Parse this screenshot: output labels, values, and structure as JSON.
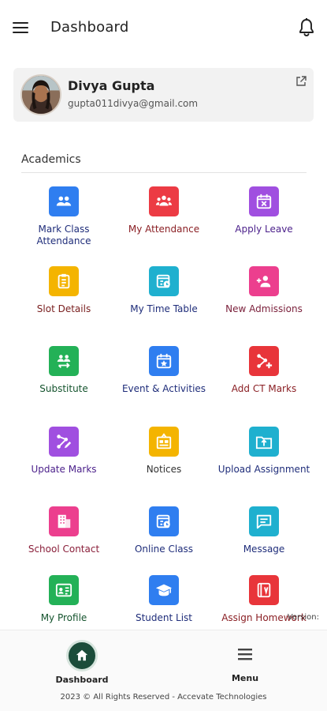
{
  "appbar": {
    "title": "Dashboard"
  },
  "profile": {
    "name": "Divya Gupta",
    "email": "gupta011divya@gmail.com"
  },
  "section": {
    "title": "Academics"
  },
  "tiles": [
    {
      "label": "Mark Class Attendance",
      "icon": "attendance-group-icon",
      "color": "#2f7ef0",
      "text_color": "#1f2d7a"
    },
    {
      "label": "My Attendance",
      "icon": "people-icon",
      "color": "#ec3b44",
      "text_color": "#8a1f24"
    },
    {
      "label": "Apply Leave",
      "icon": "calendar-x-icon",
      "color": "#a04fe0",
      "text_color": "#4a1f8a"
    },
    {
      "label": "Slot Details",
      "icon": "clipboard-icon",
      "color": "#f4b400",
      "text_color": "#7a2020"
    },
    {
      "label": "My Time Table",
      "icon": "timetable-icon",
      "color": "#1fb0cf",
      "text_color": "#1f2d7a"
    },
    {
      "label": "New Admissions",
      "icon": "add-user-icon",
      "color": "#ec3f8e",
      "text_color": "#7a1f3a"
    },
    {
      "label": "Substitute",
      "icon": "swap-users-icon",
      "color": "#23b157",
      "text_color": "#14532d"
    },
    {
      "label": "Event & Activities",
      "icon": "calendar-star-icon",
      "color": "#2f7ef0",
      "text_color": "#1f2d7a"
    },
    {
      "label": "Add CT Marks",
      "icon": "graph-plus-icon",
      "color": "#e8353a",
      "text_color": "#8a1f24"
    },
    {
      "label": "Update Marks",
      "icon": "graph-edit-icon",
      "color": "#a04fe0",
      "text_color": "#4a1f8a"
    },
    {
      "label": "Notices",
      "icon": "notice-board-icon",
      "color": "#f4b400",
      "text_color": "#333333"
    },
    {
      "label": "Upload Assignment",
      "icon": "folder-upload-icon",
      "color": "#1fb0cf",
      "text_color": "#1f2d7a"
    },
    {
      "label": "School Contact",
      "icon": "building-icon",
      "color": "#ec3f8e",
      "text_color": "#8a1f3a"
    },
    {
      "label": "Online Class",
      "icon": "online-class-icon",
      "color": "#2f7ef0",
      "text_color": "#1f2d7a"
    },
    {
      "label": "Message",
      "icon": "message-icon",
      "color": "#1fb0cf",
      "text_color": "#1f2d7a"
    },
    {
      "label": "My Profile",
      "icon": "id-card-icon",
      "color": "#23b157",
      "text_color": "#14532d"
    },
    {
      "label": "Student List",
      "icon": "graduation-cap-icon",
      "color": "#2f7ef0",
      "text_color": "#1f2d7a"
    },
    {
      "label": "Assign Homework",
      "icon": "homework-icon",
      "color": "#e8353a",
      "text_color": "#8a1f24"
    }
  ],
  "version_label": "Version:",
  "bottom_nav": [
    {
      "label": "Dashboard",
      "icon": "home-icon",
      "active": true
    },
    {
      "label": "Menu",
      "icon": "menu-icon",
      "active": false
    }
  ],
  "footer": {
    "copyright": "2023 © All Rights Reserved - Accevate Technologies"
  }
}
